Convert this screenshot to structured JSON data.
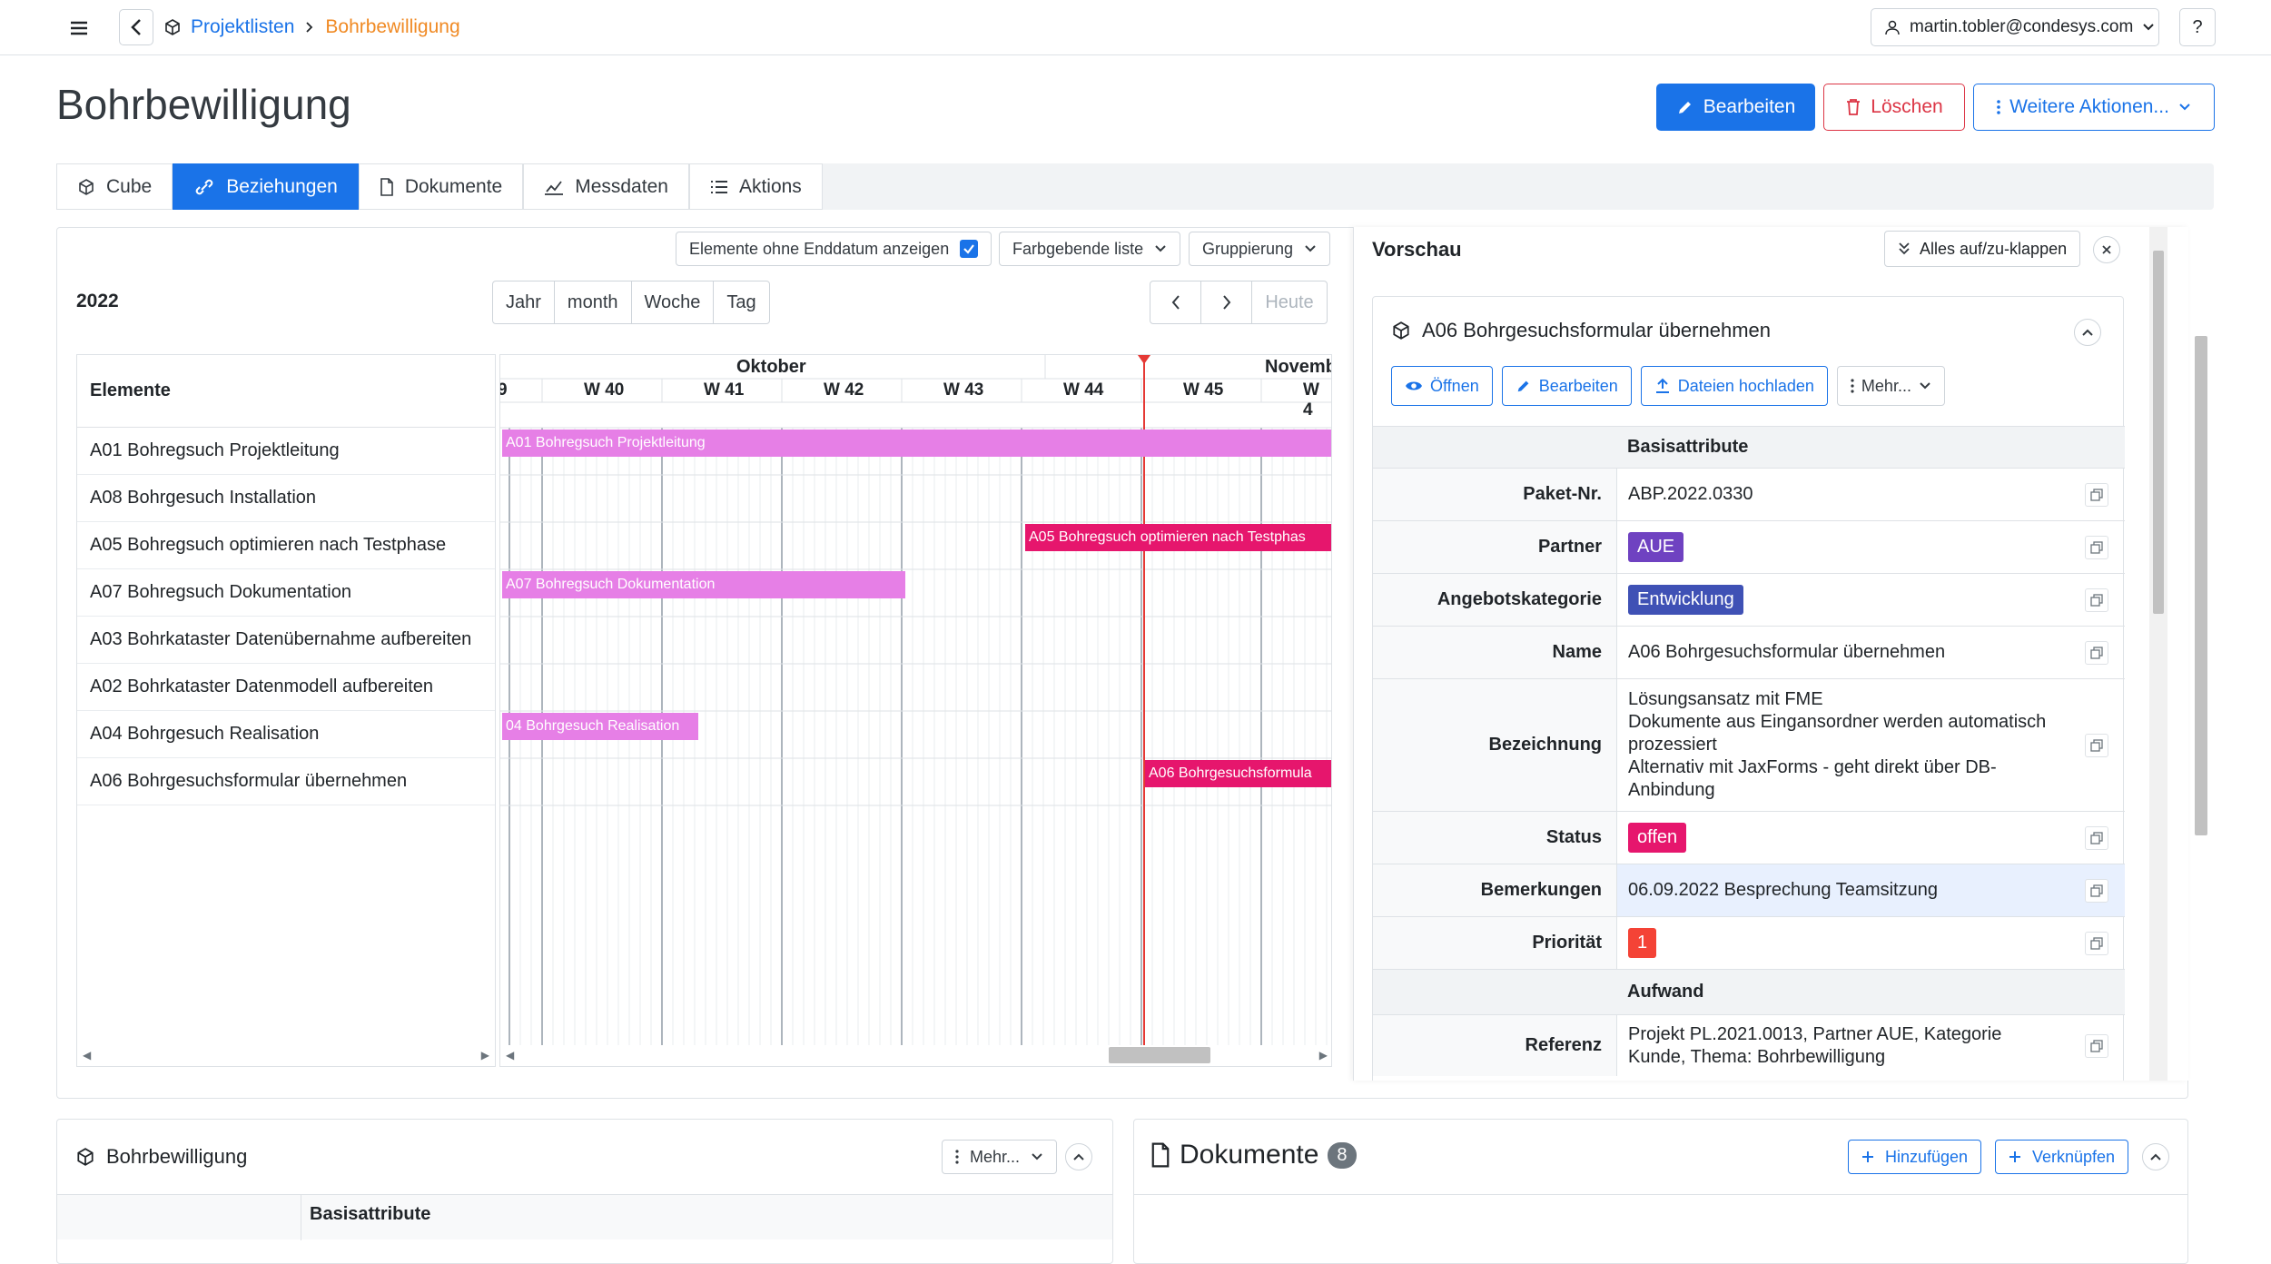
{
  "breadcrumb": {
    "parent": "Projektlisten",
    "current": "Bohrbewilligung"
  },
  "user": {
    "email": "martin.tobler@condesys.com"
  },
  "help_label": "?",
  "page_title": "Bohrbewilligung",
  "actions": {
    "edit": "Bearbeiten",
    "delete": "Löschen",
    "more": "Weitere Aktionen..."
  },
  "tabs": [
    {
      "label": "Cube"
    },
    {
      "label": "Beziehungen"
    },
    {
      "label": "Dokumente"
    },
    {
      "label": "Messdaten"
    },
    {
      "label": "Aktions"
    }
  ],
  "gantt": {
    "show_no_end_label": "Elemente ohne Enddatum anzeigen",
    "color_list": "Farbgebende liste",
    "grouping": "Gruppierung",
    "year": "2022",
    "views": [
      "Jahr",
      "month",
      "Woche",
      "Tag"
    ],
    "today": "Heute",
    "col_header": "Elemente",
    "months": [
      "Oktober",
      "Novembe"
    ],
    "weeks": [
      "9",
      "W 40",
      "W 41",
      "W 42",
      "W 43",
      "W 44",
      "W 45",
      "W 4"
    ],
    "rows": [
      "A01 Bohregsuch Projektleitung",
      "A08 Bohrgesuch Installation",
      "A05 Bohregsuch optimieren nach Testphase",
      "A07 Bohregsuch Dokumentation",
      "A03 Bohrkataster Datenübernahme aufbereiten",
      "A02 Bohrkataster Datenmodell aufbereiten",
      "A04 Bohrgesuch Realisation",
      "A06 Bohrgesuchsformular übernehmen"
    ],
    "bars": [
      {
        "row": 0,
        "label": "A01 Bohregsuch Projektleitung"
      },
      {
        "row": 2,
        "label": "A05 Bohregsuch optimieren nach Testphas"
      },
      {
        "row": 3,
        "label": "A07 Bohregsuch Dokumentation"
      },
      {
        "row": 6,
        "label": "04 Bohrgesuch Realisation"
      },
      {
        "row": 7,
        "label": "A06 Bohrgesuchsformula"
      }
    ]
  },
  "preview": {
    "title": "Vorschau",
    "toggle_all": "Alles auf/zu-klappen",
    "item_title": "A06 Bohrgesuchsformular übernehmen",
    "buttons": {
      "open": "Öffnen",
      "edit": "Bearbeiten",
      "upload": "Dateien hochladen",
      "more": "Mehr..."
    },
    "section1": "Basisattribute",
    "section2": "Aufwand",
    "attrs": {
      "paket_k": "Paket-Nr.",
      "paket_v": "ABP.2022.0330",
      "partner_k": "Partner",
      "partner_v": "AUE",
      "kat_k": "Angebotskategorie",
      "kat_v": "Entwicklung",
      "name_k": "Name",
      "name_v": "A06 Bohrgesuchsformular übernehmen",
      "bez_k": "Bezeichnung",
      "bez_l1": "Lösungsansatz mit FME",
      "bez_l2": "Dokumente aus Eingansordner werden automatisch prozessiert",
      "bez_l3": "Alternativ mit JaxForms - geht direkt über DB-Anbindung",
      "status_k": "Status",
      "status_v": "offen",
      "bem_k": "Bemerkungen",
      "bem_v": "06.09.2022 Besprechung Teamsitzung",
      "prio_k": "Priorität",
      "prio_v": "1",
      "ref_k": "Referenz",
      "ref_v": "Projekt PL.2021.0013, Partner AUE, Kategorie Kunde, Thema: Bohrbewilligung"
    }
  },
  "bottom": {
    "left_title": "Bohrbewilligung",
    "left_more": "Mehr...",
    "left_section": "Basisattribute",
    "right_title": "Dokumente",
    "right_count": "8",
    "add": "Hinzufügen",
    "link": "Verknüpfen"
  },
  "colors": {
    "accent": "#1a73e8",
    "danger": "#dc3545",
    "pink_bar": "#e67fe6",
    "red_bar": "#e6166d",
    "partner_badge": "#6f42c1",
    "category_badge": "#3f51b5",
    "status_badge": "#e6166d",
    "priority_badge": "#f44336"
  }
}
